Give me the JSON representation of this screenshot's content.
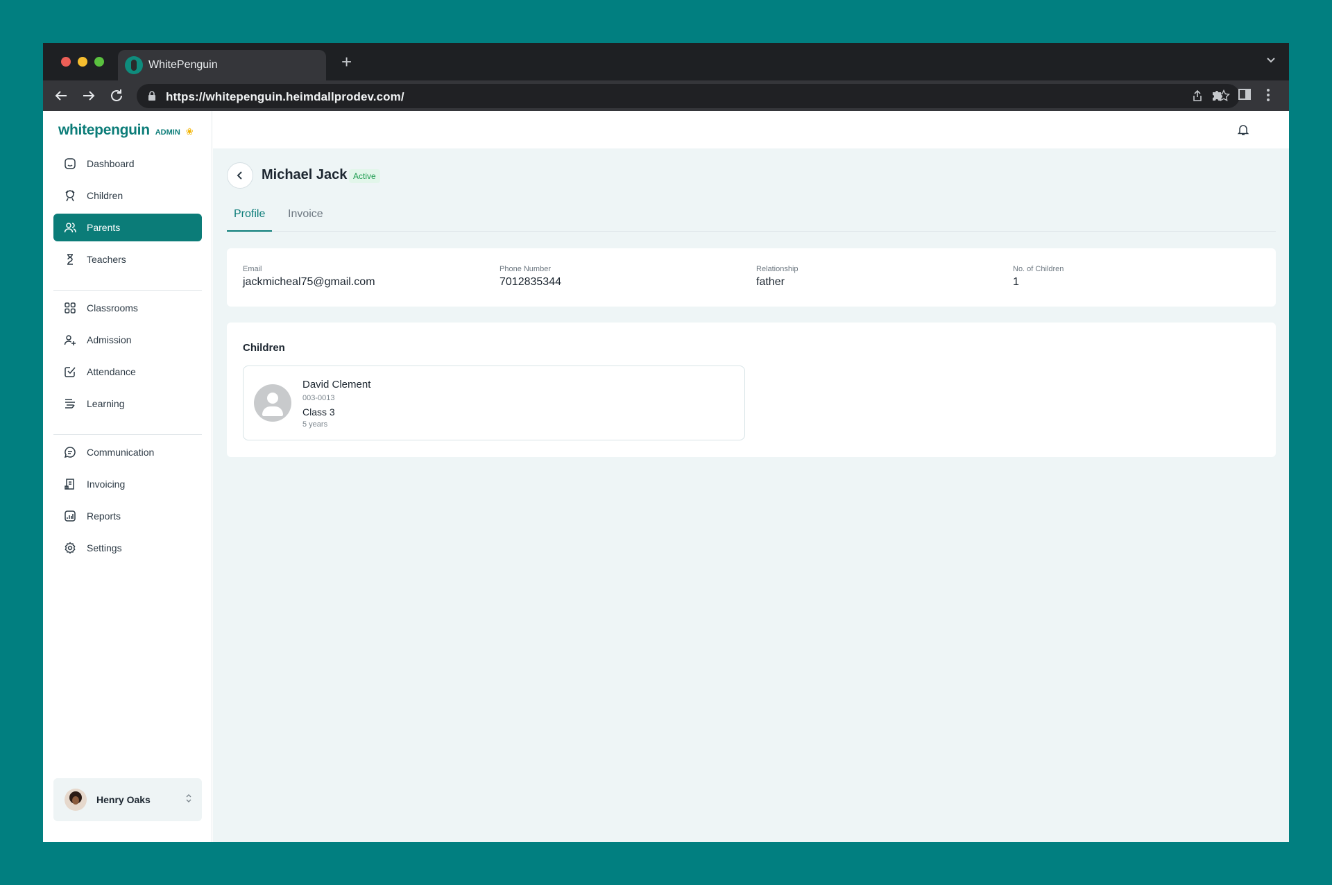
{
  "browser": {
    "tab_title": "WhitePenguin",
    "new_tab": "+",
    "url": "https://whitepenguin.heimdallprodev.com/",
    "traffic_lights": [
      "#ed5f57",
      "#f6be2f",
      "#5ac13f"
    ]
  },
  "brand": {
    "name": "whitepenguin",
    "role": "ADMIN",
    "accent": "#0b7c78"
  },
  "sidebar": {
    "items": [
      {
        "label": "Dashboard",
        "icon": "dashboard-icon"
      },
      {
        "label": "Children",
        "icon": "children-icon"
      },
      {
        "label": "Parents",
        "icon": "parents-icon",
        "active": true
      },
      {
        "label": "Teachers",
        "icon": "teachers-icon"
      },
      {
        "label": "Classrooms",
        "icon": "classrooms-icon"
      },
      {
        "label": "Admission",
        "icon": "admission-icon"
      },
      {
        "label": "Attendance",
        "icon": "attendance-icon"
      },
      {
        "label": "Learning",
        "icon": "learning-icon"
      },
      {
        "label": "Communication",
        "icon": "communication-icon"
      },
      {
        "label": "Invoicing",
        "icon": "invoicing-icon"
      },
      {
        "label": "Reports",
        "icon": "reports-icon"
      },
      {
        "label": "Settings",
        "icon": "settings-icon"
      }
    ],
    "user": {
      "name": "Henry Oaks"
    }
  },
  "parent": {
    "name": "Michael Jack",
    "status": "Active",
    "tabs": [
      {
        "label": "Profile",
        "active": true
      },
      {
        "label": "Invoice",
        "active": false
      }
    ],
    "fields": [
      {
        "label": "Email",
        "value": "jackmicheal75@gmail.com"
      },
      {
        "label": "Phone Number",
        "value": "7012835344"
      },
      {
        "label": "Relationship",
        "value": "father"
      },
      {
        "label": "No. of Children",
        "value": "1"
      }
    ]
  },
  "children_section": {
    "title": "Children",
    "items": [
      {
        "name": "David Clement",
        "id": "003-0013",
        "class": "Class 3",
        "age": "5 years"
      }
    ]
  }
}
